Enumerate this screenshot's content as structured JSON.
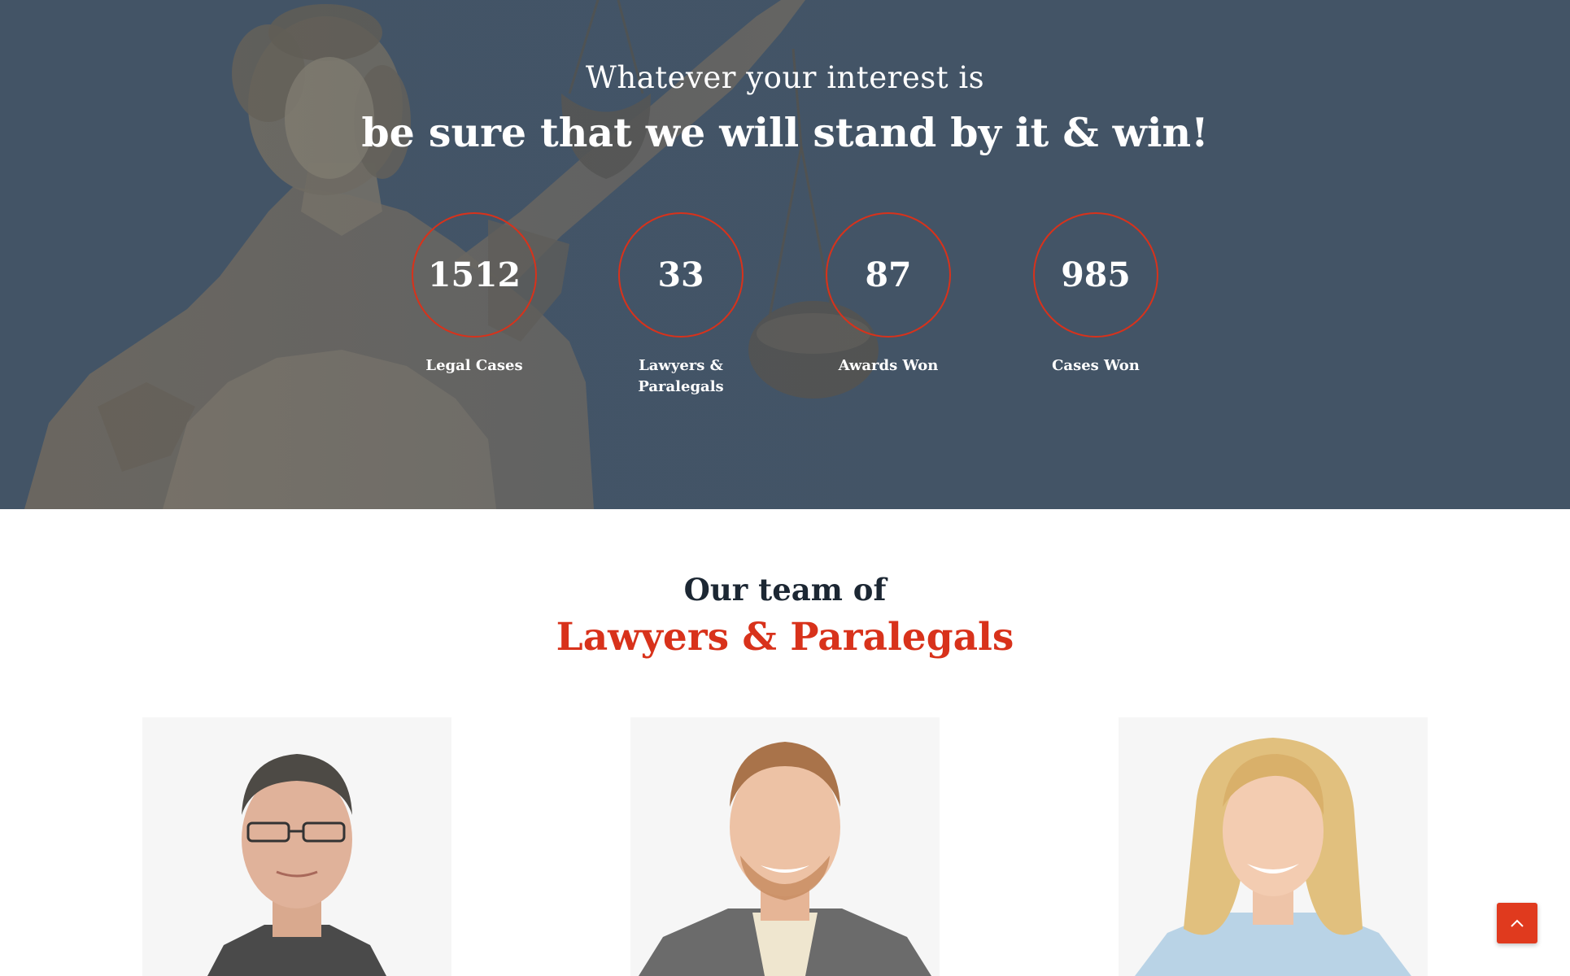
{
  "hero": {
    "intro": "Whatever your interest is",
    "headline": "be sure that we will stand by it & win!",
    "counters": [
      {
        "value": "1512",
        "label": "Legal Cases"
      },
      {
        "value": "33",
        "label": "Lawyers & Paralegals"
      },
      {
        "value": "87",
        "label": "Awards Won"
      },
      {
        "value": "985",
        "label": "Cases Won"
      }
    ]
  },
  "team": {
    "pretitle": "Our team of",
    "title": "Lawyers & Paralegals"
  },
  "colors": {
    "accent": "#d8321b",
    "hero_overlay": "#435466",
    "heading_dark": "#1c2733",
    "card_bg": "#f6f6f6"
  },
  "icons": {
    "scroll_top": "chevron-up-icon"
  }
}
